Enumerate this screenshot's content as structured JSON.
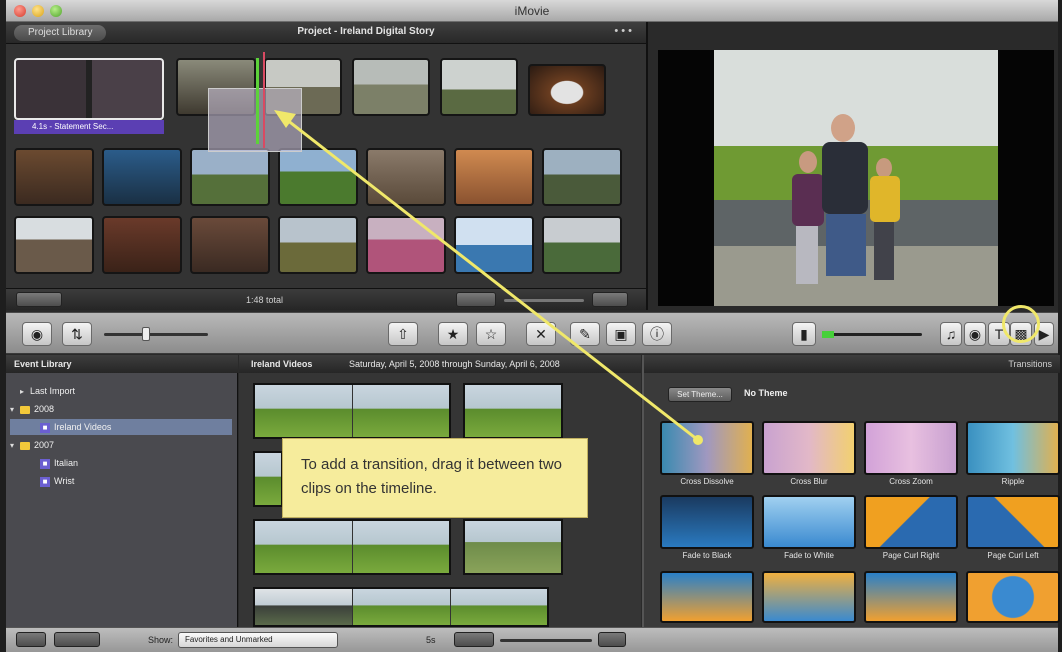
{
  "window": {
    "title": "iMovie"
  },
  "project": {
    "library_tab": "Project Library",
    "title": "Project - Ireland Digital Story",
    "more": "• • •",
    "strip_label": "4.1s - Statement Sec..."
  },
  "project_footer": {
    "total": "1:48 total"
  },
  "event_library": {
    "header": "Event Library",
    "items": [
      {
        "label": "Last Import",
        "type": "item"
      },
      {
        "label": "2008",
        "type": "folder"
      },
      {
        "label": "Ireland Videos",
        "type": "event",
        "selected": true
      },
      {
        "label": "2007",
        "type": "folder"
      },
      {
        "label": "Italian",
        "type": "event"
      },
      {
        "label": "Wrist",
        "type": "event"
      }
    ]
  },
  "event_browser": {
    "event_name": "Ireland Videos",
    "date_range": "Saturday, April 5, 2008 through Sunday, April 6, 2008"
  },
  "callout": {
    "text": "To add a transition, drag it between two clips on the timeline."
  },
  "transitions": {
    "header": "Transitions",
    "set_theme": "Set Theme...",
    "theme": "No Theme",
    "items": [
      {
        "label": "Cross Dissolve",
        "style": "dissolve"
      },
      {
        "label": "Cross Blur",
        "style": "blur"
      },
      {
        "label": "Cross Zoom",
        "style": "zoom"
      },
      {
        "label": "Ripple",
        "style": "ripple"
      },
      {
        "label": "Fade to Black",
        "style": "black"
      },
      {
        "label": "Fade to White",
        "style": "white"
      },
      {
        "label": "Page Curl Right",
        "style": "curl"
      },
      {
        "label": "Page Curl Left",
        "style": "curl"
      },
      {
        "label": "",
        "style": "cube"
      },
      {
        "label": "",
        "style": "mosaic"
      },
      {
        "label": "",
        "style": "spin"
      },
      {
        "label": "",
        "style": "circle"
      }
    ]
  },
  "bottom_bar": {
    "show_label": "Show:",
    "show_value": "Favorites and Unmarked",
    "scale_label": "5s"
  },
  "colors": {
    "highlight_ring": "#f0e86a",
    "arrow": "#f0e86a",
    "event_icon": "#6b5fd1",
    "folder": "#f2c83a"
  }
}
